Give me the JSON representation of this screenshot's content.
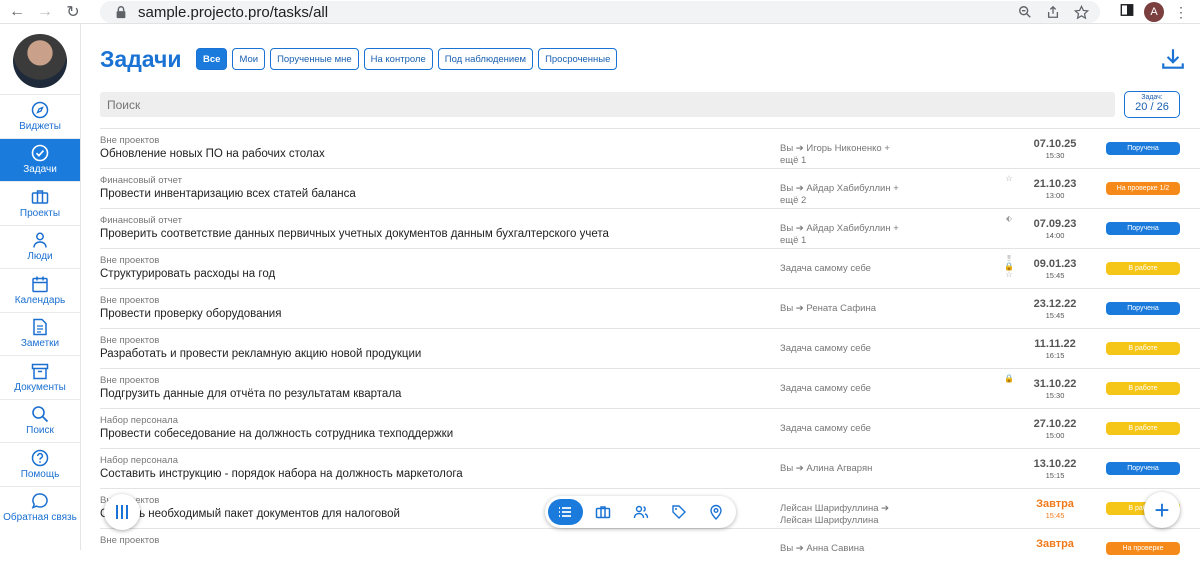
{
  "browser": {
    "url": "sample.projecto.pro/tasks/all",
    "profile_initial": "A"
  },
  "sidebar": {
    "items": [
      {
        "label": "Виджеты",
        "icon": "compass-icon"
      },
      {
        "label": "Задачи",
        "icon": "check-circle-icon",
        "active": true
      },
      {
        "label": "Проекты",
        "icon": "briefcase-icon"
      },
      {
        "label": "Люди",
        "icon": "person-icon"
      },
      {
        "label": "Календарь",
        "icon": "calendar-icon"
      },
      {
        "label": "Заметки",
        "icon": "note-icon"
      },
      {
        "label": "Документы",
        "icon": "archive-icon"
      },
      {
        "label": "Поиск",
        "icon": "search-icon"
      },
      {
        "label": "Помощь",
        "icon": "help-icon"
      },
      {
        "label": "Обратная связь",
        "icon": "chat-icon"
      }
    ]
  },
  "header": {
    "title": "Задачи",
    "filters": [
      "Все",
      "Мои",
      "Порученные мне",
      "На контроле",
      "Под наблюдением",
      "Просроченные"
    ],
    "active_filter": "Все"
  },
  "search": {
    "placeholder": "Поиск"
  },
  "counter": {
    "label": "Задач:",
    "value": "20 / 26"
  },
  "colors": {
    "accent": "#1a7bdc",
    "assigned": "#1a7bdc",
    "in_progress": "#f5c518",
    "review": "#f58a1a",
    "overdue": "#f07a1a"
  },
  "tasks": [
    {
      "category": "Вне проектов",
      "name": "Обновление новых ПО на рабочих столах",
      "who": "Вы  ➔  Игорь Никоненко + ещё 1",
      "marks": "",
      "date": "07.10.25",
      "time": "15:30",
      "status": "Поручена",
      "status_type": "assigned"
    },
    {
      "category": "Финансовый отчет",
      "name": "Провести инвентаризацию всех статей баланса",
      "who": "Вы  ➔  Айдар Хабибуллин + ещё 2",
      "marks": "☆",
      "date": "21.10.23",
      "time": "13:00",
      "status": "На проверке 1/2",
      "status_type": "review"
    },
    {
      "category": "Финансовый отчет",
      "name": "Проверить соответствие данных первичных учетных документов данным бухгалтерского учета",
      "who": "Вы  ➔  Айдар Хабибуллин + ещё 1",
      "marks": "⬖",
      "date": "07.09.23",
      "time": "14:00",
      "status": "Поручена",
      "status_type": "assigned"
    },
    {
      "category": "Вне проектов",
      "name": "Структурировать расходы на год",
      "who": "Задача самому себе",
      "marks": "‼ 🔒 ☆",
      "date": "09.01.23",
      "time": "15:45",
      "status": "В работе",
      "status_type": "in_progress"
    },
    {
      "category": "Вне проектов",
      "name": "Провести проверку оборудования",
      "who": "Вы  ➔  Рената Сафина",
      "marks": "",
      "date": "23.12.22",
      "time": "15:45",
      "status": "Поручена",
      "status_type": "assigned"
    },
    {
      "category": "Вне проектов",
      "name": "Разработать и провести рекламную акцию новой продукции",
      "who": "Задача самому себе",
      "marks": "",
      "date": "11.11.22",
      "time": "16:15",
      "status": "В работе",
      "status_type": "in_progress"
    },
    {
      "category": "Вне проектов",
      "name": "Подгрузить данные для отчёта по результатам квартала",
      "who": "Задача самому себе",
      "marks": "🔒",
      "date": "31.10.22",
      "time": "15:30",
      "status": "В работе",
      "status_type": "in_progress"
    },
    {
      "category": "Набор персонала",
      "name": "Провести собеседование на должность сотрудника техподдержки",
      "who": "Задача самому себе",
      "marks": "",
      "date": "27.10.22",
      "time": "15:00",
      "status": "В работе",
      "status_type": "in_progress"
    },
    {
      "category": "Набор персонала",
      "name": "Составить инструкцию - порядок набора на должность маркетолога",
      "who": "Вы  ➔  Алина Агварян",
      "marks": "",
      "date": "13.10.22",
      "time": "15:15",
      "status": "Поручена",
      "status_type": "assigned"
    },
    {
      "category": "Вне проектов",
      "name": "Собрать необходимый пакет документов для налоговой",
      "who": "Лейсан Шарифуллина  ➔  Лейсан Шарифуллина",
      "marks": "",
      "date": "Завтра",
      "time": "15:45",
      "status": "В работе",
      "status_type": "in_progress",
      "orange": true
    },
    {
      "category": "Вне проектов",
      "name": "",
      "who": "Вы  ➔  Анна Савина",
      "marks": "",
      "date": "Завтра",
      "time": "",
      "status": "На проверке",
      "status_type": "review",
      "orange": true
    }
  ]
}
